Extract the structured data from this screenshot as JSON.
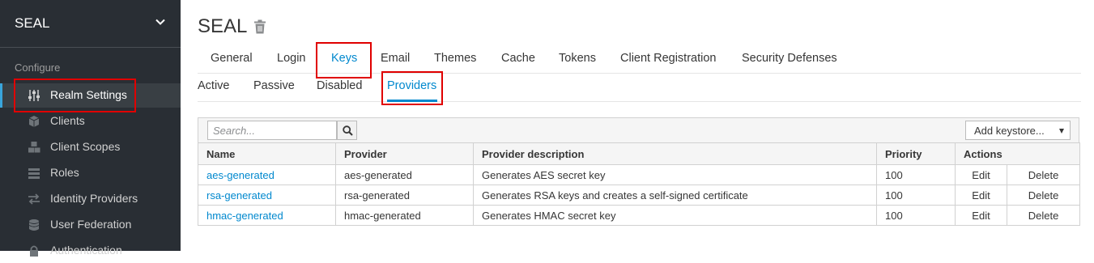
{
  "sidebar": {
    "realm": "SEAL",
    "section_label": "Configure",
    "items": [
      {
        "label": "Realm Settings",
        "icon": "sliders-icon"
      },
      {
        "label": "Clients",
        "icon": "cube-icon"
      },
      {
        "label": "Client Scopes",
        "icon": "cubes-icon"
      },
      {
        "label": "Roles",
        "icon": "list-icon"
      },
      {
        "label": "Identity Providers",
        "icon": "exchange-icon"
      },
      {
        "label": "User Federation",
        "icon": "database-icon"
      },
      {
        "label": "Authentication",
        "icon": "lock-icon"
      }
    ]
  },
  "header": {
    "title": "SEAL"
  },
  "tabs": [
    "General",
    "Login",
    "Keys",
    "Email",
    "Themes",
    "Cache",
    "Tokens",
    "Client Registration",
    "Security Defenses"
  ],
  "active_tab": "Keys",
  "subtabs": [
    "Active",
    "Passive",
    "Disabled",
    "Providers"
  ],
  "active_subtab": "Providers",
  "toolbar": {
    "search_placeholder": "Search...",
    "add_keystore": "Add keystore..."
  },
  "table": {
    "columns": [
      "Name",
      "Provider",
      "Provider description",
      "Priority",
      "Actions"
    ],
    "rows": [
      {
        "name": "aes-generated",
        "provider": "aes-generated",
        "description": "Generates AES secret key",
        "priority": "100",
        "edit": "Edit",
        "delete": "Delete"
      },
      {
        "name": "rsa-generated",
        "provider": "rsa-generated",
        "description": "Generates RSA keys and creates a self-signed certificate",
        "priority": "100",
        "edit": "Edit",
        "delete": "Delete"
      },
      {
        "name": "hmac-generated",
        "provider": "hmac-generated",
        "description": "Generates HMAC secret key",
        "priority": "100",
        "edit": "Edit",
        "delete": "Delete"
      }
    ]
  },
  "colors": {
    "sidebar_bg": "#292e34",
    "accent": "#0088ce",
    "highlight_box": "#e00000"
  }
}
